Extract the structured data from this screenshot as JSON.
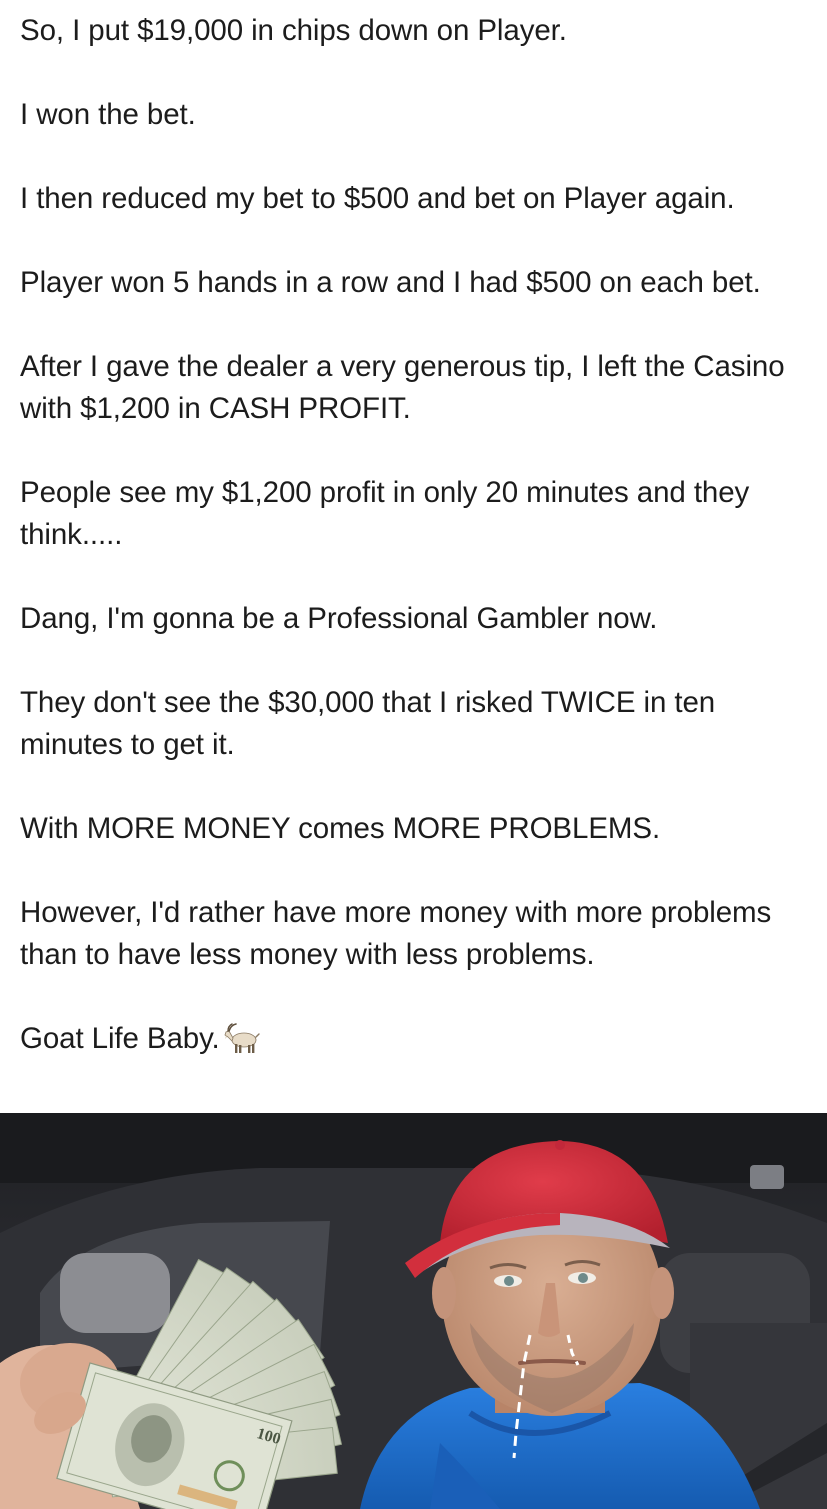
{
  "post": {
    "paragraphs": [
      "So, I put $19,000 in chips down on Player.",
      "I won the bet.",
      "I then reduced my bet to $500 and bet on Player again.",
      "Player won 5 hands in a row and I had $500 on each bet.",
      "After I gave the dealer a very generous tip, I left the Casino with $1,200 in CASH PROFIT.",
      "People see my $1,200 profit in only 20 minutes and they think.....",
      "Dang, I'm gonna be a Professional Gambler now.",
      "They don't see the $30,000 that I risked TWICE in ten minutes to get it.",
      "With MORE MONEY comes MORE PROBLEMS.",
      "However, I'd rather have more money with more problems than to have less money with less problems.",
      "Goat Life Baby."
    ],
    "emoji": "goat-icon"
  },
  "photo": {
    "subject": "man-in-car-holding-cash-photo",
    "bill_denomination": "100",
    "colors": {
      "cap": "#d7303f",
      "hoodie": "#1f6fd0",
      "interior": "#2a2b2f"
    }
  }
}
